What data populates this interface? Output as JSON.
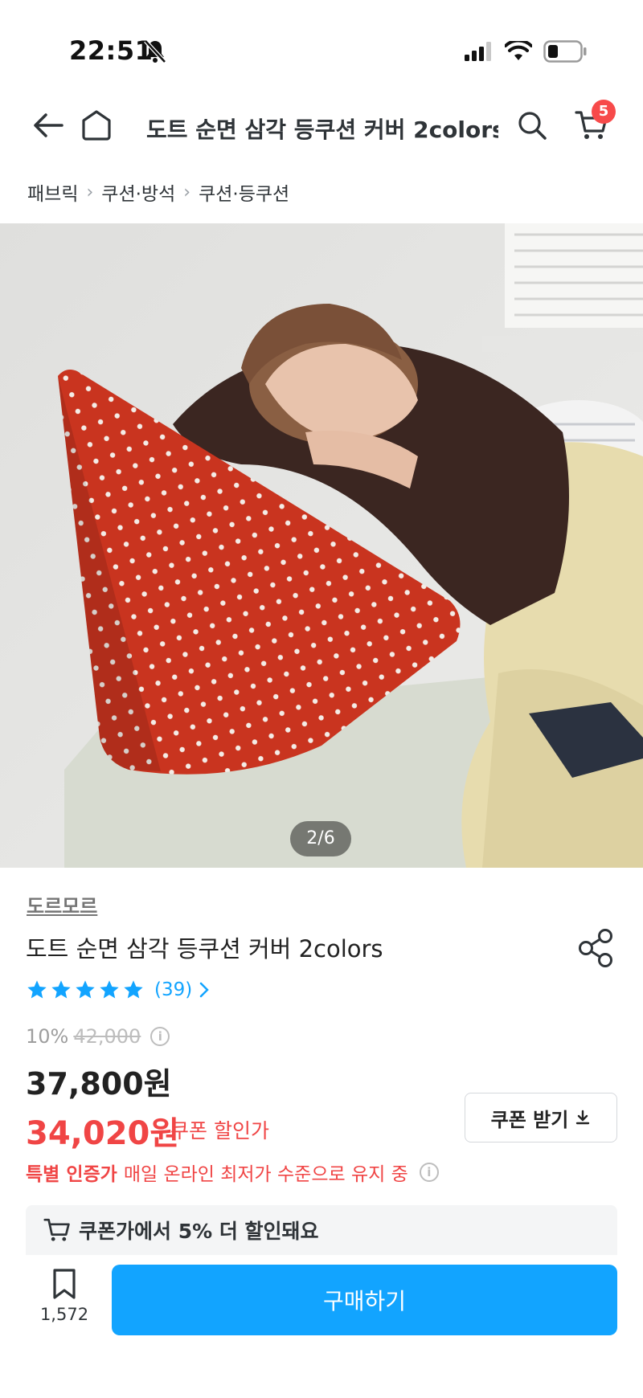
{
  "status_bar": {
    "time": "22:51",
    "icons": [
      "bell-slash-icon",
      "signal-icon",
      "wifi-icon",
      "battery-icon"
    ]
  },
  "header": {
    "title": "도트 순면 삼각 등쿠션 커버 2colors",
    "cart_count": "5",
    "icons": [
      "back-arrow-icon",
      "home-icon",
      "search-icon",
      "cart-icon"
    ]
  },
  "breadcrumb": [
    "패브릭",
    "쿠션·방석",
    "쿠션·등쿠션"
  ],
  "gallery": {
    "indicator": "2/6"
  },
  "product": {
    "brand": "도르모르",
    "title": "도트 순면 삼각 등쿠션 커버 2colors",
    "rating_stars": 5,
    "review_count": "(39)",
    "discount_rate": "10%",
    "original_price": "42,000",
    "price": "37,800원",
    "coupon_price": "34,020원",
    "coupon_price_label": "쿠폰 할인가",
    "coupon_button": "쿠폰 받기",
    "special_label": "특별 인증가",
    "special_text": "매일 온라인 최저가 수준으로 유지 중",
    "coupon_banner": "쿠폰가에서 5% 더 할인돼요"
  },
  "bottom_bar": {
    "bookmark_count": "1,572",
    "buy_label": "구매하기"
  },
  "colors": {
    "accent": "#12a4ff",
    "sale_red": "#f04545",
    "badge_red": "#f74a4a",
    "cushion_red": "#c9341f"
  }
}
